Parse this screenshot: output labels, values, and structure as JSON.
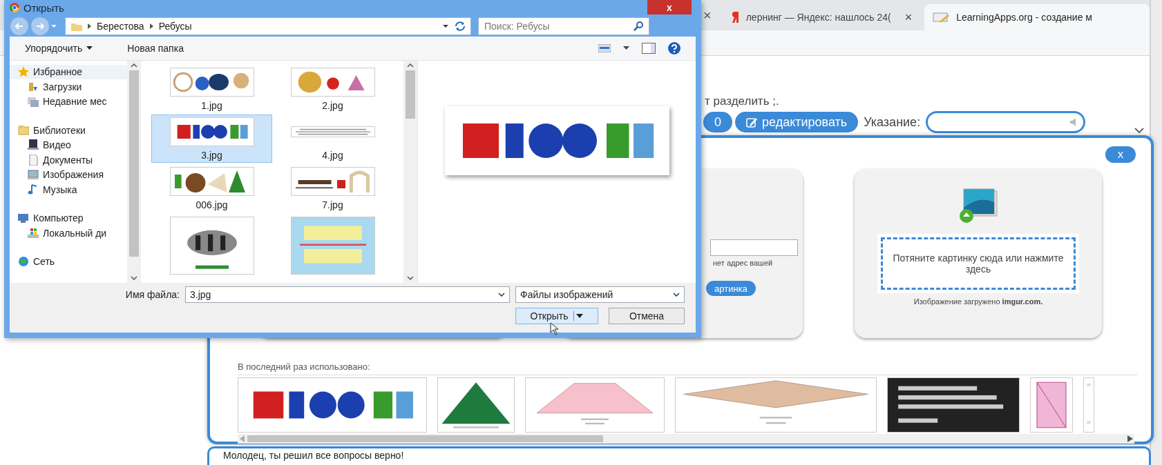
{
  "browser": {
    "hidden_tab_close": "×",
    "tabs": [
      {
        "title": "лернинг — Яндекс: нашлось 24(",
        "close": "×",
        "selected": false
      },
      {
        "title": "LearningApps.org - создание м",
        "selected": true
      }
    ]
  },
  "page": {
    "hint": "т разделить ;.",
    "counter_button": "0",
    "edit_button": "редактировать",
    "instruction_label": "Указание:",
    "footer_text": "Молодец, ты решил все вопросы верно!"
  },
  "image_modal": {
    "close": "x",
    "url_card": {
      "note": "нет адрес вашей",
      "button": "артинка"
    },
    "upload_card": {
      "drop_text": "Потяните картинку сюда или нажмите здесь",
      "note": "Изображение загружено **imgur.com.**"
    },
    "recent_label": "В последний раз использовано:",
    "recent": [
      {
        "kind": "rebus"
      },
      {
        "kind": "triangle"
      },
      {
        "kind": "trapezoid"
      },
      {
        "kind": "rhombus"
      },
      {
        "kind": "dark"
      },
      {
        "kind": "rectangle"
      },
      {
        "kind": "blank"
      }
    ]
  },
  "file_dialog": {
    "title": "Открыть",
    "close": "x",
    "path": [
      "Берестова",
      "Ребусы"
    ],
    "search_placeholder": "Поиск: Ребусы",
    "toolbar": {
      "organize": "Упорядочить",
      "new_folder": "Новая папка"
    },
    "nav": [
      {
        "label": "Избранное",
        "selected": true,
        "children": [
          {
            "label": "Загрузки",
            "selected": false
          },
          {
            "label": "Недавние мес",
            "selected": false
          }
        ]
      },
      {
        "label": "Библиотеки",
        "selected": false,
        "children": [
          {
            "label": "Видео",
            "selected": false
          },
          {
            "label": "Документы",
            "selected": false
          },
          {
            "label": "Изображения",
            "selected": false
          },
          {
            "label": "Музыка",
            "selected": false
          }
        ]
      },
      {
        "label": "Компьютер",
        "selected": false,
        "children": [
          {
            "label": "Локальный ди",
            "selected": false
          }
        ]
      },
      {
        "label": "Сеть",
        "selected": false
      }
    ],
    "files": [
      {
        "name": "1.jpg",
        "kind": "wide",
        "selected": false
      },
      {
        "name": "2.jpg",
        "kind": "wide",
        "selected": false
      },
      {
        "name": "3.jpg",
        "kind": "wide",
        "selected": true
      },
      {
        "name": "4.jpg",
        "kind": "strip",
        "selected": false
      },
      {
        "name": "006.jpg",
        "kind": "wide",
        "selected": false
      },
      {
        "name": "7.jpg",
        "kind": "wide",
        "selected": false
      },
      {
        "kind": "square",
        "selected": false
      },
      {
        "kind": "square",
        "selected": false
      }
    ],
    "filename_label": "Имя файла:",
    "filename": "3.jpg",
    "filter": "Файлы изображений",
    "open_button": "Открыть",
    "cancel_button": "Отмена"
  }
}
